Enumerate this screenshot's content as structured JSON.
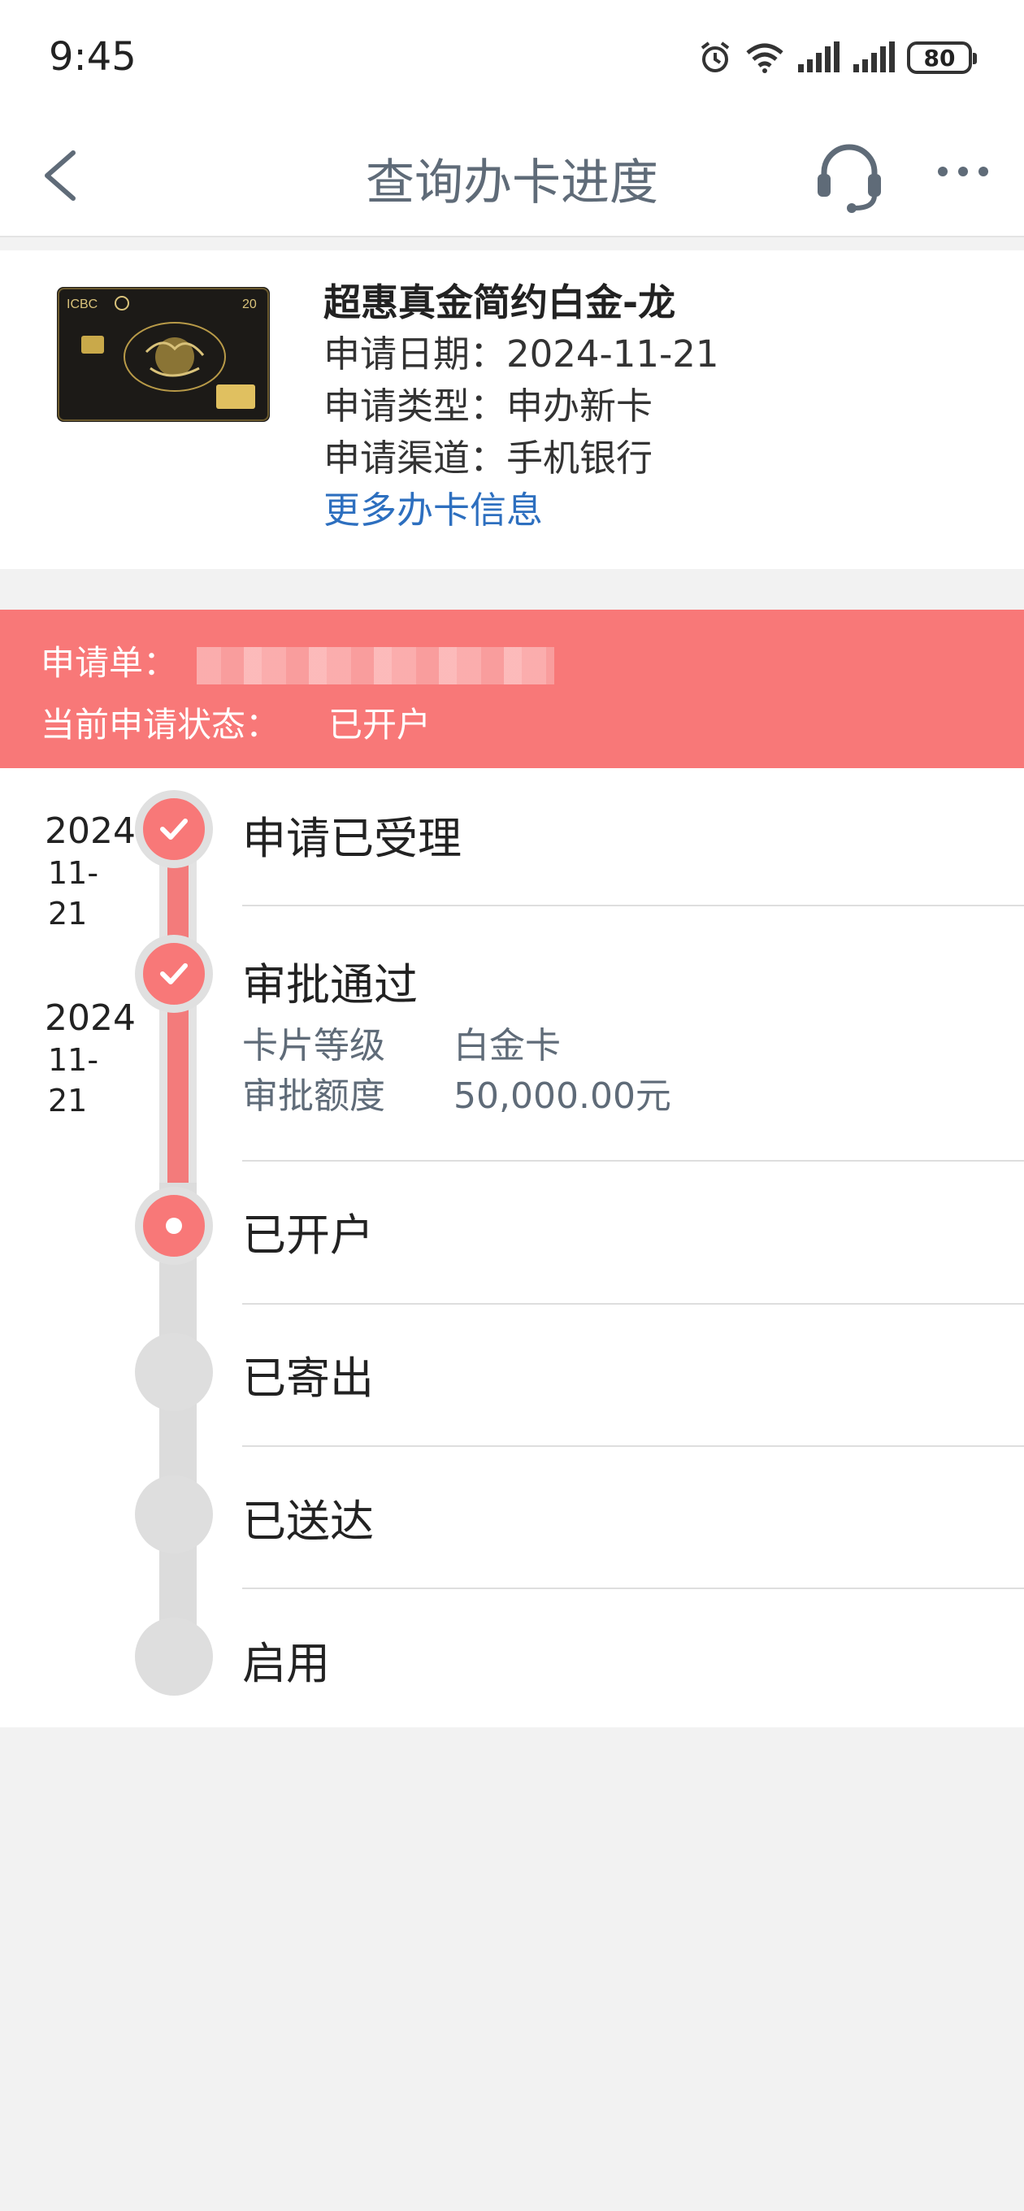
{
  "statusbar": {
    "time": "9:45",
    "battery": "80"
  },
  "nav": {
    "title": "查询办卡进度"
  },
  "card": {
    "name": "超惠真金简约白金-龙",
    "apply_date": "申请日期：2024-11-21",
    "apply_type": "申请类型：申办新卡",
    "apply_channel": "申请渠道：手机银行",
    "more_link": "更多办卡信息",
    "image_text": "ICBC"
  },
  "banner": {
    "order_label": "申请单：",
    "status_label": "当前申请状态：",
    "status_value": "已开户"
  },
  "timeline": {
    "steps": [
      {
        "label": "申请已受理",
        "year": "2024",
        "md1": "11-",
        "md2": "21"
      },
      {
        "label": "审批通过",
        "year": "2024",
        "md1": "11-",
        "md2": "21",
        "details": [
          {
            "key": "卡片等级",
            "value": "白金卡"
          },
          {
            "key": "审批额度",
            "value": "50,000.00元"
          }
        ]
      },
      {
        "label": "已开户"
      },
      {
        "label": "已寄出"
      },
      {
        "label": "已送达"
      },
      {
        "label": "启用"
      }
    ]
  },
  "colors": {
    "accent": "#f87878",
    "link": "#2d6fbf",
    "title": "#5f6b78"
  }
}
